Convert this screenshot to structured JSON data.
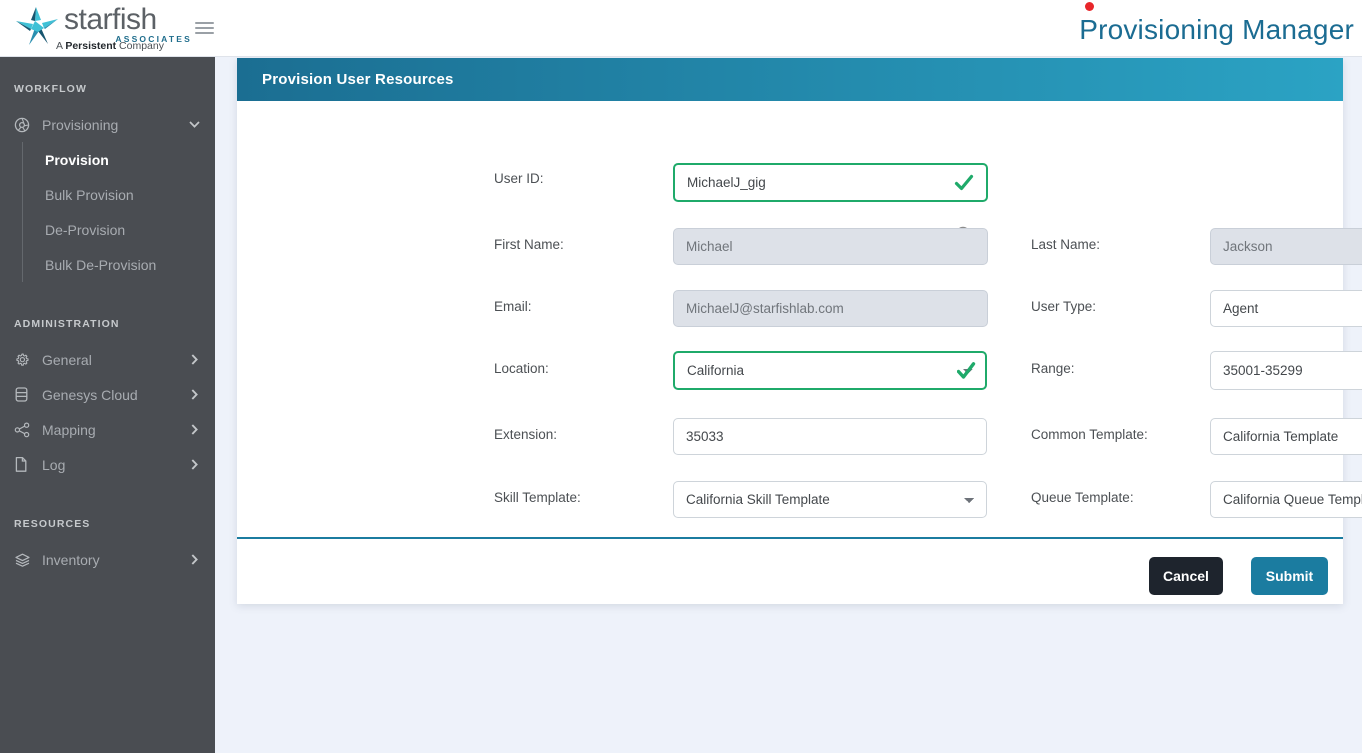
{
  "brand": {
    "word": "starfish",
    "associates": "ASSOCIATES",
    "tagline_prefix": "A ",
    "tagline_bold": "Persistent",
    "tagline_suffix": " Company",
    "star_color_light": "#3fc1d6",
    "star_color_dark": "#17556f"
  },
  "header": {
    "app_title": "Provisioning Manager",
    "app_title_color": "#1b6c92",
    "notification_dot_color": "#e8262a",
    "menu_icon": "hamburger-icon"
  },
  "sidebar": {
    "sections": [
      {
        "label": "WORKFLOW",
        "items": [
          {
            "label": "Provisioning",
            "icon": "provisioning-icon",
            "expanded": true,
            "chevron": "chevron-down-icon",
            "children": [
              {
                "label": "Provision",
                "active": true
              },
              {
                "label": "Bulk Provision",
                "active": false
              },
              {
                "label": "De-Provision",
                "active": false
              },
              {
                "label": "Bulk De-Provision",
                "active": false
              }
            ]
          }
        ]
      },
      {
        "label": "ADMINISTRATION",
        "items": [
          {
            "label": "General",
            "icon": "gear-icon",
            "chevron": "chevron-right-icon",
            "children": []
          },
          {
            "label": "Genesys Cloud",
            "icon": "database-icon",
            "chevron": "chevron-right-icon",
            "children": []
          },
          {
            "label": "Mapping",
            "icon": "share-nodes-icon",
            "chevron": "chevron-right-icon",
            "children": []
          },
          {
            "label": "Log",
            "icon": "file-icon",
            "chevron": "chevron-right-icon",
            "children": []
          }
        ]
      },
      {
        "label": "RESOURCES",
        "items": [
          {
            "label": "Inventory",
            "icon": "layers-icon",
            "chevron": "chevron-right-icon",
            "children": []
          }
        ]
      }
    ]
  },
  "panel": {
    "title": "Provision User Resources",
    "header_gradient_from": "#1b6e92",
    "header_gradient_to": "#2ba3c4",
    "divider_color": "#1b7ca0",
    "valid_color": "#1faa6a",
    "fields": {
      "user_id": {
        "label": "User ID:",
        "value": "MichaelJ_gig",
        "valid": true,
        "search_icon": "magnifier-icon"
      },
      "first_name": {
        "label": "First Name:",
        "value": "Michael",
        "disabled": true
      },
      "last_name": {
        "label": "Last Name:",
        "value": "Jackson",
        "disabled": true
      },
      "email": {
        "label": "Email:",
        "value": "MichaelJ@starfishlab.com",
        "disabled": true
      },
      "user_type": {
        "label": "User Type:",
        "value": "Agent",
        "options": [
          "Agent"
        ]
      },
      "location": {
        "label": "Location:",
        "value": "California",
        "valid": true,
        "options": [
          "California"
        ]
      },
      "range": {
        "label": "Range:",
        "value": "35001-35299",
        "options": [
          "35001-35299"
        ]
      },
      "extension": {
        "label": "Extension:",
        "value": "35033"
      },
      "common_template": {
        "label": "Common Template:",
        "value": "California Template",
        "options": [
          "California Template"
        ]
      },
      "skill_template": {
        "label": "Skill Template:",
        "value": "California Skill Template",
        "options": [
          "California Skill Template"
        ]
      },
      "queue_template": {
        "label": "Queue Template:",
        "value": "California Queue Template",
        "options": [
          "California Queue Template"
        ]
      }
    },
    "buttons": {
      "cancel": "Cancel",
      "submit": "Submit",
      "cancel_color": "#1e242d",
      "submit_color": "#1b7ca0"
    }
  }
}
